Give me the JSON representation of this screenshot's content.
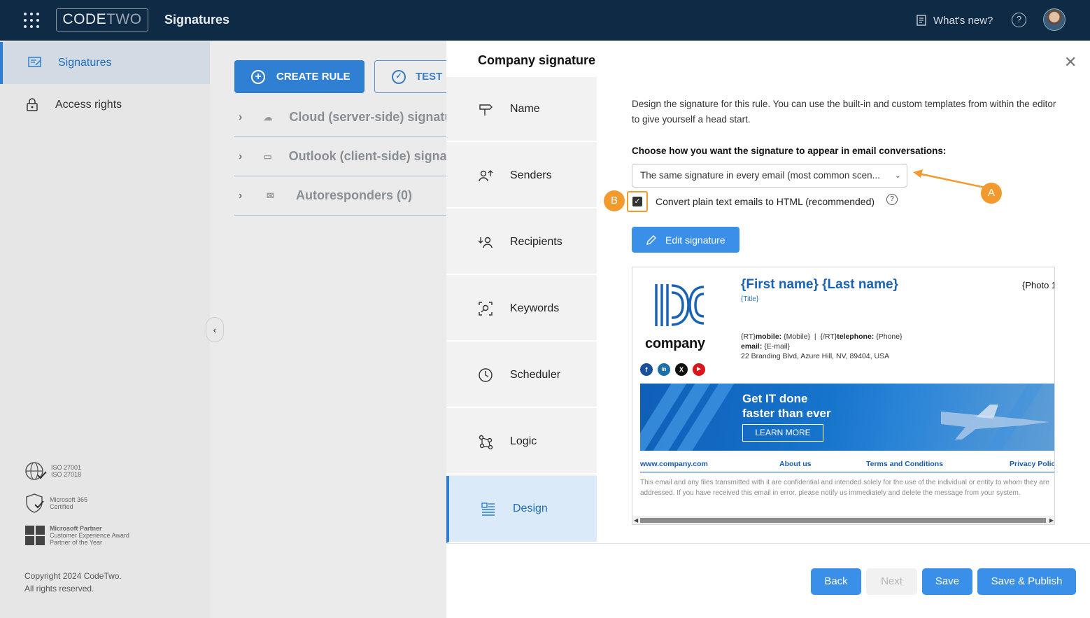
{
  "topbar": {
    "brand_code": "CODE",
    "brand_two": "TWO",
    "app_title": "Signatures",
    "whats_new": "What's new?",
    "help_glyph": "?"
  },
  "sidebar": {
    "items": [
      {
        "label": "Signatures",
        "icon": "signature-icon",
        "active": true
      },
      {
        "label": "Access rights",
        "icon": "lock-icon",
        "active": false
      }
    ],
    "certs": [
      {
        "line1": "ISO 27001",
        "line2": "ISO 27018"
      },
      {
        "line1": "Microsoft 365",
        "line2": "Certified"
      },
      {
        "line1": "Microsoft Partner",
        "line2": "Customer Experience Award",
        "line3": "Partner of the Year"
      }
    ],
    "copyright_1": "Copyright 2024 CodeTwo.",
    "copyright_2": "All rights reserved."
  },
  "main": {
    "create_rule": "CREATE RULE",
    "test": "TEST",
    "rules": [
      {
        "label": "Cloud (server-side) signatures"
      },
      {
        "label": "Outlook (client-side) signatures"
      },
      {
        "label": "Autoresponders (0)"
      }
    ]
  },
  "panel": {
    "title": "Company signature",
    "steps": [
      {
        "label": "Name",
        "icon": "signpost-icon"
      },
      {
        "label": "Senders",
        "icon": "senders-icon"
      },
      {
        "label": "Recipients",
        "icon": "recipients-icon"
      },
      {
        "label": "Keywords",
        "icon": "keywords-icon"
      },
      {
        "label": "Scheduler",
        "icon": "clock-icon"
      },
      {
        "label": "Logic",
        "icon": "logic-icon"
      },
      {
        "label": "Design",
        "icon": "design-icon",
        "active": true
      }
    ],
    "intro": "Design the signature for this rule. You can use the built-in and custom templates from within the editor to give yourself a head start.",
    "choose_label": "Choose how you want the signature to appear in email conversations:",
    "select_value": "The same signature in every email (most common scen...",
    "checkbox_label": "Convert plain text emails to HTML (recommended)",
    "checkbox_checked": true,
    "edit_button": "Edit signature",
    "badge_a": "A",
    "badge_b": "B",
    "accent_color": "#f29a2e"
  },
  "preview": {
    "name": "{First name} {Last name}",
    "title": "{Title}",
    "photo": "{Photo 1",
    "company": "company",
    "contact_prefix": "{RT}",
    "mobile_label": "mobile:",
    "mobile_value": "{Mobile}",
    "contact_sep": "|",
    "telephone_prefix": "{/RT}",
    "telephone_label": "telephone:",
    "telephone_value": "{Phone}",
    "email_label": "email:",
    "email_value": "{E-mail}",
    "address": "22 Branding Blvd, Azure Hill, NV, 89404, USA",
    "social": [
      "f",
      "in",
      "X",
      "▶"
    ],
    "banner_line1": "Get IT done",
    "banner_line2": "faster than ever",
    "banner_button": "LEARN MORE",
    "links": [
      "www.company.com",
      "About us",
      "Terms and Conditions",
      "Privacy Polic"
    ],
    "disclaimer": "This email and any files transmitted with it are confidential and intended solely for the use of the individual or entity to whom they are addressed. If you have received this email in error, please notify us immediately and delete the message from your system."
  },
  "footer": {
    "back": "Back",
    "next": "Next",
    "save": "Save",
    "save_publish": "Save & Publish"
  }
}
